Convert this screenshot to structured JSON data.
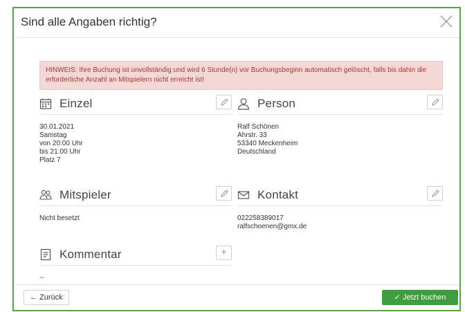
{
  "modal": {
    "title": "Sind alle Angaben richtig?",
    "alert": "HINWEIS: Ihre Buchung ist unvollständig und wird 6 Stunde(n) vor Buchungsbeginn automatisch gelöscht, falls bis dahin die erforderliche Anzahl an Mitspielern nicht erreicht ist!"
  },
  "sections": {
    "einzel": {
      "title": "Einzel",
      "lines": [
        "30.01.2021",
        "Samstag",
        "von 20:00 Uhr",
        "bis 21:00 Uhr",
        "Platz 7"
      ]
    },
    "person": {
      "title": "Person",
      "lines": [
        "Ralf Schönen",
        "Ahrstr. 33",
        "53340 Meckenheim",
        "Deutschland"
      ]
    },
    "mitspieler": {
      "title": "Mitspieler",
      "lines": [
        "Nicht besetzt"
      ]
    },
    "kontakt": {
      "title": "Kontakt",
      "lines": [
        "022258389017",
        "ralfschoenen@gmx.de"
      ]
    },
    "kommentar": {
      "title": "Kommentar",
      "lines": [
        "--"
      ]
    }
  },
  "footer": {
    "back_label": "← Zurück",
    "book_label": "✓ Jetzt buchen"
  },
  "colors": {
    "frame": "#5aa33a",
    "alert_bg": "#f2d7d7",
    "alert_text": "#a33a2a",
    "primary": "#3e9d3d"
  }
}
